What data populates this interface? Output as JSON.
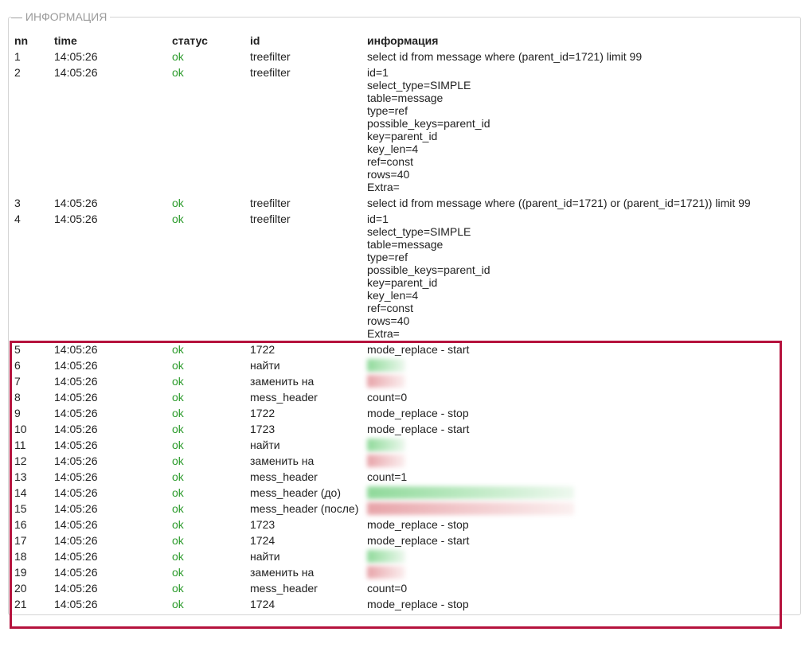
{
  "panel": {
    "legend": "— ИНФОРМАЦИЯ"
  },
  "columns": {
    "nn": "nn",
    "time": "time",
    "status": "статус",
    "id": "id",
    "info": "информация"
  },
  "rows": [
    {
      "nn": "1",
      "time": "14:05:26",
      "status": "ok",
      "id": "treefilter",
      "info": [
        "select id from message where  (parent_id=1721) limit 99"
      ]
    },
    {
      "nn": "2",
      "time": "14:05:26",
      "status": "ok",
      "id": "treefilter",
      "info": [
        "id=1",
        "select_type=SIMPLE",
        "table=message",
        "type=ref",
        "possible_keys=parent_id",
        "key=parent_id",
        "key_len=4",
        "ref=const",
        "rows=40",
        "Extra="
      ]
    },
    {
      "nn": "3",
      "time": "14:05:26",
      "status": "ok",
      "id": "treefilter",
      "info": [
        "select id from message where ((parent_id=1721) or (parent_id=1721)) limit 99"
      ]
    },
    {
      "nn": "4",
      "time": "14:05:26",
      "status": "ok",
      "id": "treefilter",
      "info": [
        "id=1",
        "select_type=SIMPLE",
        "table=message",
        "type=ref",
        "possible_keys=parent_id",
        "key=parent_id",
        "key_len=4",
        "ref=const",
        "rows=40",
        "Extra="
      ]
    },
    {
      "nn": "5",
      "time": "14:05:26",
      "status": "ok",
      "id": "1722",
      "info": [
        "mode_replace - start"
      ]
    },
    {
      "nn": "6",
      "time": "14:05:26",
      "status": "ok",
      "id": "найти",
      "blurred": "green"
    },
    {
      "nn": "7",
      "time": "14:05:26",
      "status": "ok",
      "id": "заменить на",
      "blurred": "red"
    },
    {
      "nn": "8",
      "time": "14:05:26",
      "status": "ok",
      "id": "mess_header",
      "info": [
        "count=0"
      ]
    },
    {
      "nn": "9",
      "time": "14:05:26",
      "status": "ok",
      "id": "1722",
      "info": [
        "mode_replace - stop"
      ]
    },
    {
      "nn": "10",
      "time": "14:05:26",
      "status": "ok",
      "id": "1723",
      "info": [
        "mode_replace - start"
      ]
    },
    {
      "nn": "11",
      "time": "14:05:26",
      "status": "ok",
      "id": "найти",
      "blurred": "green"
    },
    {
      "nn": "12",
      "time": "14:05:26",
      "status": "ok",
      "id": "заменить на",
      "blurred": "red"
    },
    {
      "nn": "13",
      "time": "14:05:26",
      "status": "ok",
      "id": "mess_header",
      "info": [
        "count=1"
      ]
    },
    {
      "nn": "14",
      "time": "14:05:26",
      "status": "ok",
      "id": "mess_header (до)",
      "blurred": "green-long"
    },
    {
      "nn": "15",
      "time": "14:05:26",
      "status": "ok",
      "id": "mess_header (после)",
      "blurred": "red-long"
    },
    {
      "nn": "16",
      "time": "14:05:26",
      "status": "ok",
      "id": "1723",
      "info": [
        "mode_replace - stop"
      ]
    },
    {
      "nn": "17",
      "time": "14:05:26",
      "status": "ok",
      "id": "1724",
      "info": [
        "mode_replace - start"
      ]
    },
    {
      "nn": "18",
      "time": "14:05:26",
      "status": "ok",
      "id": "найти",
      "blurred": "green"
    },
    {
      "nn": "19",
      "time": "14:05:26",
      "status": "ok",
      "id": "заменить на",
      "blurred": "red"
    },
    {
      "nn": "20",
      "time": "14:05:26",
      "status": "ok",
      "id": "mess_header",
      "info": [
        "count=0"
      ]
    },
    {
      "nn": "21",
      "time": "14:05:26",
      "status": "ok",
      "id": "1724",
      "info": [
        "mode_replace - stop"
      ]
    }
  ],
  "colors": {
    "ok": "#2a9a2a",
    "highlight": "#b5123d",
    "border": "#d4d4d4"
  }
}
